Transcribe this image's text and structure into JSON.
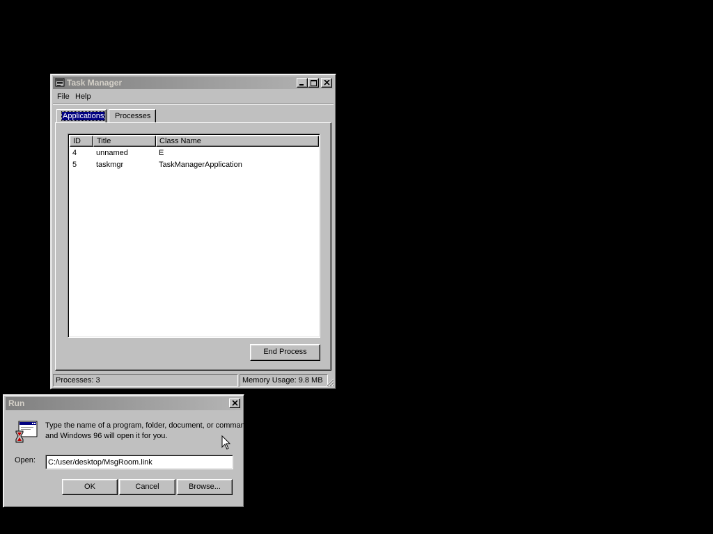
{
  "task_manager": {
    "title": "Task Manager",
    "menu": [
      "File",
      "Help"
    ],
    "tabs": [
      {
        "label": "Applications",
        "active": true
      },
      {
        "label": "Processes",
        "active": false
      }
    ],
    "columns": [
      "ID",
      "Title",
      "Class Name"
    ],
    "rows": [
      {
        "id": "4",
        "title": "unnamed",
        "class_name": "E"
      },
      {
        "id": "5",
        "title": "taskmgr",
        "class_name": "TaskManagerApplication"
      }
    ],
    "end_process_label": "End Process",
    "status": {
      "processes": "Processes: 3",
      "memory": "Memory Usage: 9.8 MB"
    }
  },
  "run_dialog": {
    "title": "Run",
    "description_line1": "Type the name of a program, folder, document, or command,",
    "description_line2": "and Windows 96 will open it for you.",
    "open_label": "Open:",
    "open_value": "C:/user/desktop/MsgRoom.link",
    "buttons": {
      "ok": "OK",
      "cancel": "Cancel",
      "browse": "Browse..."
    }
  },
  "colors": {
    "desktop": "#000000",
    "window_face": "#c0c0c0",
    "inactive_title_start": "#808080",
    "inactive_title_end": "#b5b5b5",
    "selection": "#000080"
  },
  "icons": [
    "taskmanager-app-icon",
    "minimize-icon",
    "maximize-icon",
    "close-icon",
    "run-program-icon",
    "mouse-cursor"
  ]
}
